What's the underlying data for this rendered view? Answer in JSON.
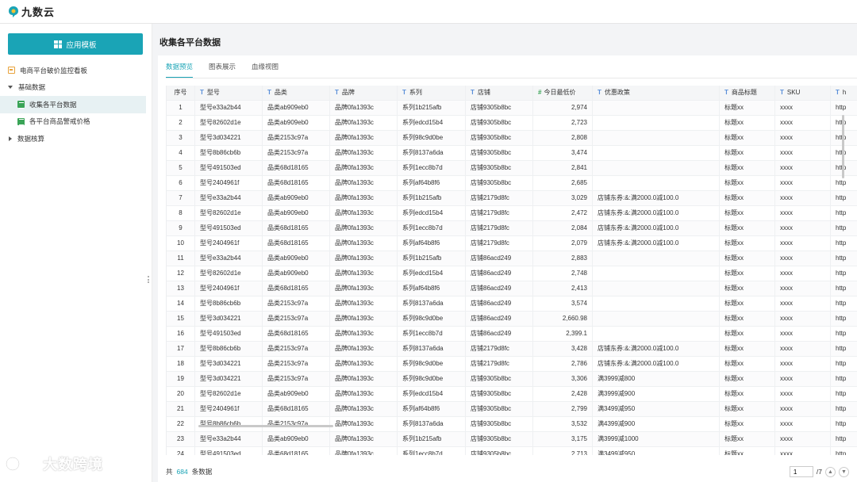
{
  "app": {
    "name": "九数云",
    "brand_color": "#1aa4b6"
  },
  "sidebar": {
    "app_button": "应用模板",
    "items": [
      {
        "label": "电商平台破价监控看板",
        "icon": "dashboard-icon"
      },
      {
        "label": "基础数据",
        "icon": "caret-down-icon"
      },
      {
        "label": "收集各平台数据",
        "icon": "table-icon"
      },
      {
        "label": "各平台商品警戒价格",
        "icon": "table-icon"
      },
      {
        "label": "数据核算",
        "icon": "caret-right-icon"
      }
    ]
  },
  "main": {
    "title": "收集各平台数据",
    "tabs": [
      "数据预览",
      "图表展示",
      "血缘视图"
    ],
    "table": {
      "headers": [
        "序号",
        "型号",
        "品类",
        "品牌",
        "系列",
        "店铺",
        "今日最低价",
        "优惠政策",
        "商品标题",
        "SKU",
        "h"
      ],
      "rows": [
        [
          "1",
          "型号e33a2b44",
          "品类ab909eb0",
          "品牌0fa1393c",
          "系列1b215afb",
          "店铺9305b8bc",
          "2,974",
          "",
          "标题xx",
          "xxxx",
          "http"
        ],
        [
          "2",
          "型号82602d1e",
          "品类ab909eb0",
          "品牌0fa1393c",
          "系列edcd15b4",
          "店铺9305b8bc",
          "2,723",
          "",
          "标题xx",
          "xxxx",
          "http"
        ],
        [
          "3",
          "型号3d034221",
          "品类2153c97a",
          "品牌0fa1393c",
          "系列98c9d0be",
          "店铺9305b8bc",
          "2,808",
          "",
          "标题xx",
          "xxxx",
          "http"
        ],
        [
          "4",
          "型号8b86cb6b",
          "品类2153c97a",
          "品牌0fa1393c",
          "系列8137a6da",
          "店铺9305b8bc",
          "3,474",
          "",
          "标题xx",
          "xxxx",
          "http"
        ],
        [
          "5",
          "型号491503ed",
          "品类68d18165",
          "品牌0fa1393c",
          "系列1ecc8b7d",
          "店铺9305b8bc",
          "2,841",
          "",
          "标题xx",
          "xxxx",
          "http"
        ],
        [
          "6",
          "型号2404961f",
          "品类68d18165",
          "品牌0fa1393c",
          "系列af64b8f6",
          "店铺9305b8bc",
          "2,685",
          "",
          "标题xx",
          "xxxx",
          "http"
        ],
        [
          "7",
          "型号e33a2b44",
          "品类ab909eb0",
          "品牌0fa1393c",
          "系列1b215afb",
          "店铺2179d8fc",
          "3,029",
          "店铺东券:&:满2000.0减100.0",
          "标题xx",
          "xxxx",
          "http"
        ],
        [
          "8",
          "型号82602d1e",
          "品类ab909eb0",
          "品牌0fa1393c",
          "系列edcd15b4",
          "店铺2179d8fc",
          "2,472",
          "店铺东券:&:满2000.0减100.0",
          "标题xx",
          "xxxx",
          "http"
        ],
        [
          "9",
          "型号491503ed",
          "品类68d18165",
          "品牌0fa1393c",
          "系列1ecc8b7d",
          "店铺2179d8fc",
          "2,084",
          "店铺东券:&:满2000.0减100.0",
          "标题xx",
          "xxxx",
          "http"
        ],
        [
          "10",
          "型号2404961f",
          "品类68d18165",
          "品牌0fa1393c",
          "系列af64b8f6",
          "店铺2179d8fc",
          "2,079",
          "店铺东券:&:满2000.0减100.0",
          "标题xx",
          "xxxx",
          "http"
        ],
        [
          "11",
          "型号e33a2b44",
          "品类ab909eb0",
          "品牌0fa1393c",
          "系列1b215afb",
          "店铺86acd249",
          "2,883",
          "",
          "标题xx",
          "xxxx",
          "http"
        ],
        [
          "12",
          "型号82602d1e",
          "品类ab909eb0",
          "品牌0fa1393c",
          "系列edcd15b4",
          "店铺86acd249",
          "2,748",
          "",
          "标题xx",
          "xxxx",
          "http"
        ],
        [
          "13",
          "型号2404961f",
          "品类68d18165",
          "品牌0fa1393c",
          "系列af64b8f6",
          "店铺86acd249",
          "2,413",
          "",
          "标题xx",
          "xxxx",
          "http"
        ],
        [
          "14",
          "型号8b86cb6b",
          "品类2153c97a",
          "品牌0fa1393c",
          "系列8137a6da",
          "店铺86acd249",
          "3,574",
          "",
          "标题xx",
          "xxxx",
          "http"
        ],
        [
          "15",
          "型号3d034221",
          "品类2153c97a",
          "品牌0fa1393c",
          "系列98c9d0be",
          "店铺86acd249",
          "2,660.98",
          "",
          "标题xx",
          "xxxx",
          "http"
        ],
        [
          "16",
          "型号491503ed",
          "品类68d18165",
          "品牌0fa1393c",
          "系列1ecc8b7d",
          "店铺86acd249",
          "2,399.1",
          "",
          "标题xx",
          "xxxx",
          "http"
        ],
        [
          "17",
          "型号8b86cb6b",
          "品类2153c97a",
          "品牌0fa1393c",
          "系列8137a6da",
          "店铺2179d8fc",
          "3,428",
          "店铺东券:&:满2000.0减100.0",
          "标题xx",
          "xxxx",
          "http"
        ],
        [
          "18",
          "型号3d034221",
          "品类2153c97a",
          "品牌0fa1393c",
          "系列98c9d0be",
          "店铺2179d8fc",
          "2,786",
          "店铺东券:&:满2000.0减100.0",
          "标题xx",
          "xxxx",
          "http"
        ],
        [
          "19",
          "型号3d034221",
          "品类2153c97a",
          "品牌0fa1393c",
          "系列98c9d0be",
          "店铺9305b8bc",
          "3,306",
          "满3999减800",
          "标题xx",
          "xxxx",
          "http"
        ],
        [
          "20",
          "型号82602d1e",
          "品类ab909eb0",
          "品牌0fa1393c",
          "系列edcd15b4",
          "店铺9305b8bc",
          "2,428",
          "满3999减900",
          "标题xx",
          "xxxx",
          "http"
        ],
        [
          "21",
          "型号2404961f",
          "品类68d18165",
          "品牌0fa1393c",
          "系列af64b8f6",
          "店铺9305b8bc",
          "2,799",
          "满3499减950",
          "标题xx",
          "xxxx",
          "http"
        ],
        [
          "22",
          "型号8b86cb6b",
          "品类2153c97a",
          "品牌0fa1393c",
          "系列8137a6da",
          "店铺9305b8bc",
          "3,532",
          "满4399减900",
          "标题xx",
          "xxxx",
          "http"
        ],
        [
          "23",
          "型号e33a2b44",
          "品类ab909eb0",
          "品牌0fa1393c",
          "系列1b215afb",
          "店铺9305b8bc",
          "3,175",
          "满3999减1000",
          "标题xx",
          "xxxx",
          "http"
        ],
        [
          "24",
          "型号491503ed",
          "品类68d18165",
          "品牌0fa1393c",
          "系列1ecc8b7d",
          "店铺9305b8bc",
          "2,713",
          "满3499减950",
          "标题xx",
          "xxxx",
          "http"
        ]
      ]
    },
    "footer": {
      "prefix": "共",
      "count": "684",
      "suffix": "条数据",
      "page": "1",
      "total_pages": "/7"
    }
  },
  "watermark": "大数跨境"
}
